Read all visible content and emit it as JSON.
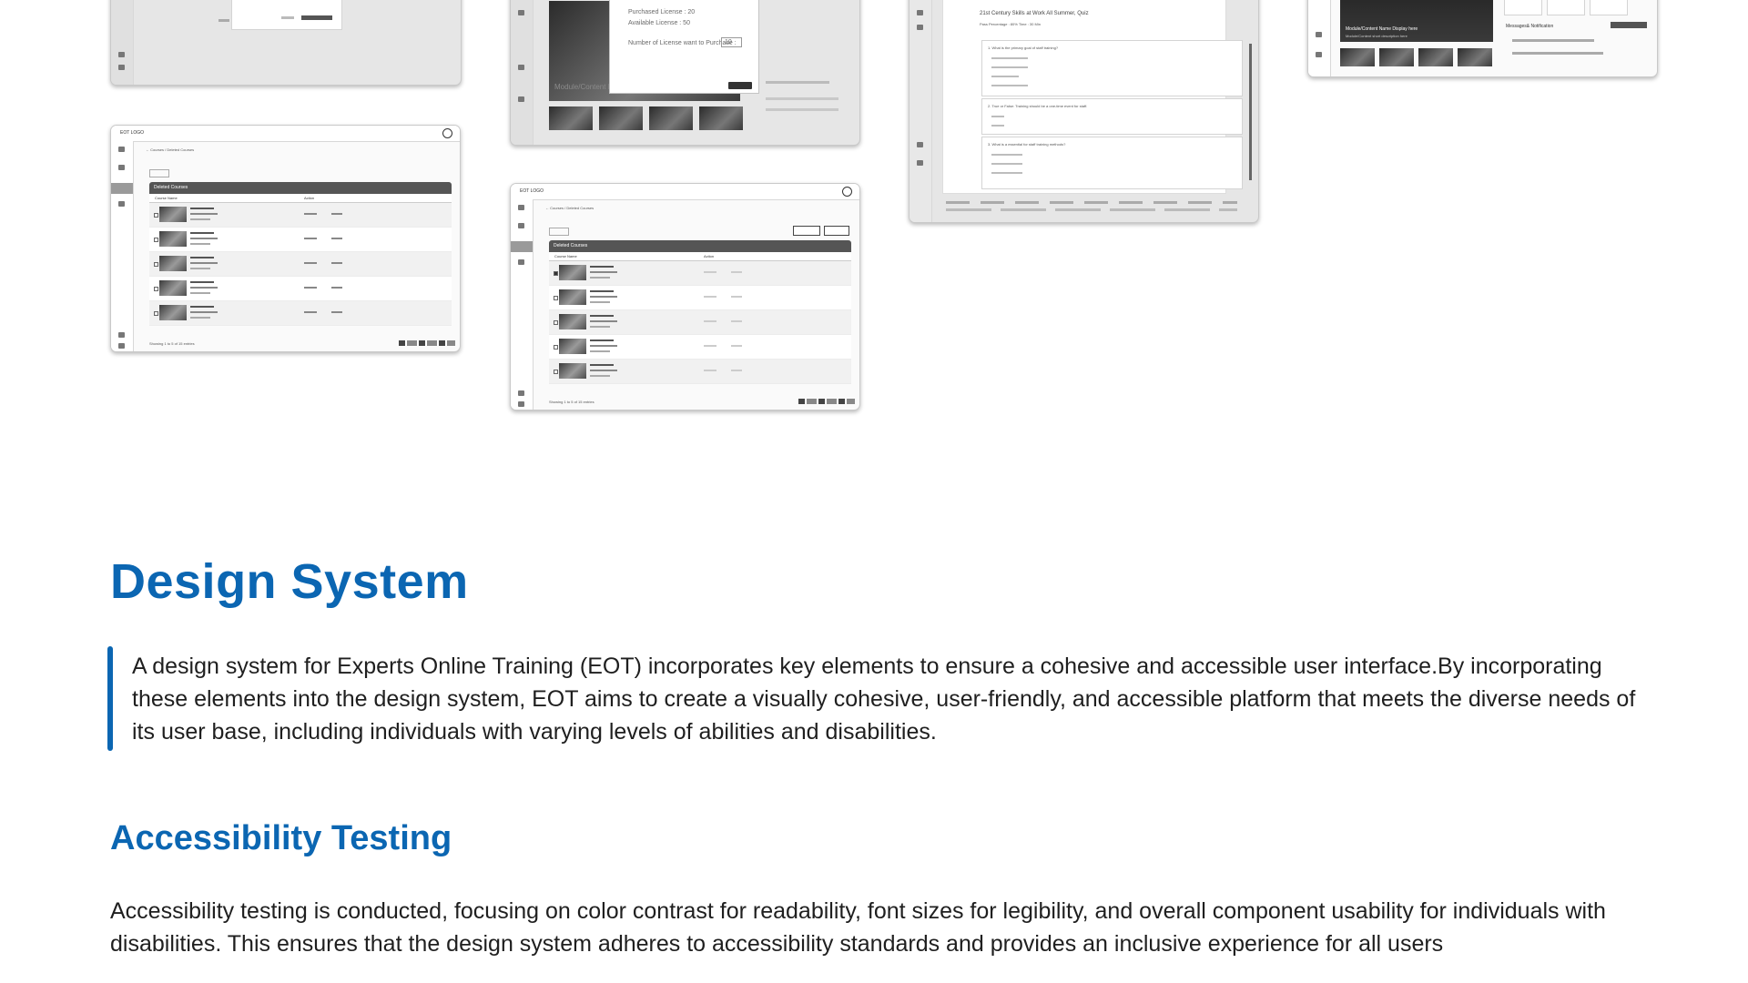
{
  "thumbnails": {
    "courses_a": {
      "logo": "EOT LOGO",
      "breadcrumb": "← Courses / Deleted Courses",
      "table_title": "Deleted Courses",
      "col_course": "Course Name",
      "col_action": "Action",
      "footer": "Showing 1 to 5 of 15 entries"
    },
    "courses_b": {
      "logo": "EOT LOGO",
      "breadcrumb": "← Courses / Deleted Courses",
      "table_title": "Deleted Courses",
      "col_course": "Course Name",
      "col_action": "Action",
      "footer": "Showing 1 to 5 of 15 entries"
    },
    "license": {
      "purchased": "Purchased License : 20",
      "available": "Available License : 50",
      "prompt": "Number of License want to Purchase :",
      "qty": "10",
      "module_label": "Module/Content N"
    },
    "quiz": {
      "title": "21st Century Skills at Work All Summer, Quiz",
      "meta": "Pass Percentage : 80%      Time : 30 Min",
      "q1": "1.  What is the primary goal of staff training?",
      "q2": "2.  True or False: Training should be a one-time event for staff.",
      "q3": "3.  What is a essential for staff training methods?"
    },
    "dashboard": {
      "banner_title": "Module/Content Name Display here",
      "banner_sub": "Module/Content short description here",
      "notif_title": "Messages& Notification"
    }
  },
  "design_system": {
    "title": "Design System",
    "description": "A design system for Experts Online Training (EOT) incorporates key elements to ensure a cohesive and accessible user interface.By incorporating these elements into the design system, EOT aims to create a visually cohesive, user-friendly, and accessible platform that meets the diverse needs of its user base, including individuals with varying levels of abilities and disabilities."
  },
  "accessibility": {
    "title": "Accessibility Testing",
    "description": "Accessibility testing is conducted, focusing on color contrast for readability, font sizes for legibility, and overall component usability for individuals with disabilities. This ensures that the design system adheres to accessibility standards and provides an inclusive experience for all users"
  },
  "colors": {
    "accent": "#0b66b2",
    "text": "#1f1f1f"
  }
}
